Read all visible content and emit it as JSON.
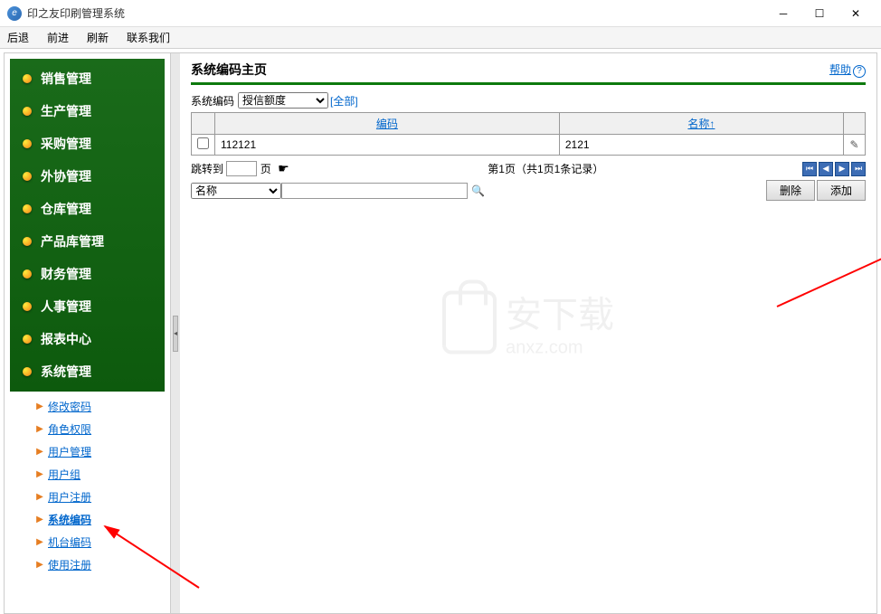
{
  "window": {
    "title": "印之友印刷管理系统"
  },
  "menubar": [
    "后退",
    "前进",
    "刷新",
    "联系我们"
  ],
  "sidebar": {
    "groups": [
      "销售管理",
      "生产管理",
      "采购管理",
      "外协管理",
      "仓库管理",
      "产品库管理",
      "财务管理",
      "人事管理",
      "报表中心",
      "系统管理"
    ],
    "sub": [
      "修改密码",
      "角色权限",
      "用户管理",
      "用户组",
      "用户注册",
      "系统编码",
      "机台编码",
      "使用注册"
    ],
    "active_sub": 5
  },
  "page": {
    "title": "系统编码主页",
    "help": "帮助",
    "filter_label": "系统编码",
    "filter_value": "授信额度",
    "filter_all": "[全部]",
    "table": {
      "headers": [
        "编码",
        "名称↑"
      ],
      "rows": [
        {
          "code": "112121",
          "name": "2121"
        }
      ]
    },
    "pager": {
      "jump_label": "跳转到",
      "page_label": "页",
      "info": "第1页（共1页1条记录）"
    },
    "search": {
      "field": "名称",
      "value": ""
    },
    "buttons": {
      "delete": "删除",
      "add": "添加"
    }
  },
  "watermark": {
    "text": "安下载",
    "sub": "anxz.com"
  }
}
